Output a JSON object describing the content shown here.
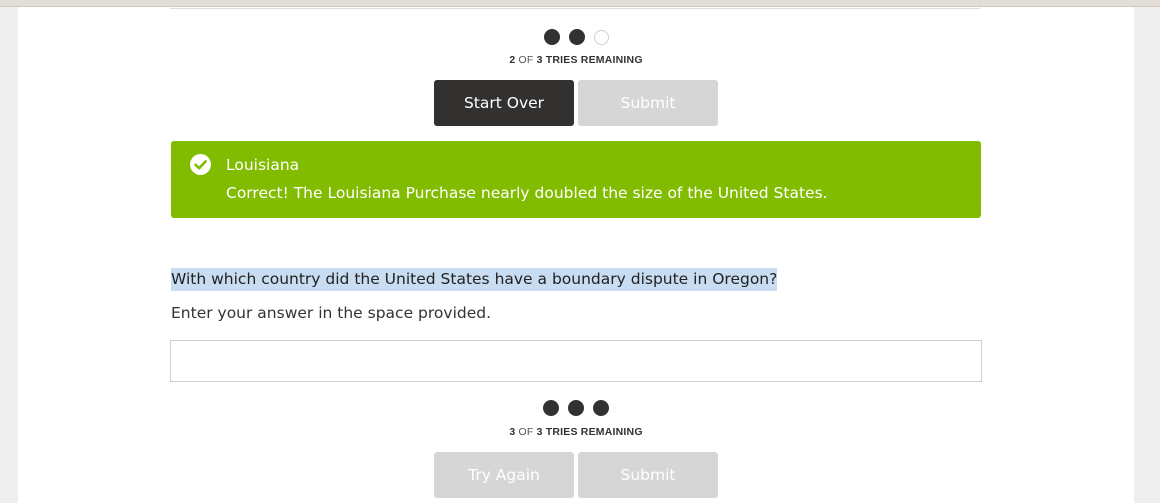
{
  "previous_question": {
    "tries": {
      "used": "2",
      "of": "OF",
      "total": "3",
      "label": "TRIES REMAINING"
    },
    "dots": [
      "filled",
      "filled",
      "empty"
    ],
    "buttons": {
      "start_over": "Start Over",
      "submit": "Submit"
    },
    "feedback": {
      "status": "correct",
      "answer": "Louisiana",
      "message": "Correct! The Louisiana Purchase nearly doubled the size of the United States.",
      "color": "#82bc00",
      "icon": "check-circle-icon"
    }
  },
  "current_question": {
    "prompt": "With which country did the United States have a boundary dispute in Oregon?",
    "instructions": "Enter your answer in the space provided.",
    "answer_value": "",
    "tries": {
      "used": "3",
      "of": "OF",
      "total": "3",
      "label": "TRIES REMAINING"
    },
    "dots": [
      "filled",
      "filled",
      "filled"
    ],
    "buttons": {
      "try_again": "Try Again",
      "submit": "Submit"
    }
  },
  "colors": {
    "dark_button": "#333130",
    "disabled_button": "#d6d6d6",
    "selection_highlight": "#c8dcf2"
  }
}
